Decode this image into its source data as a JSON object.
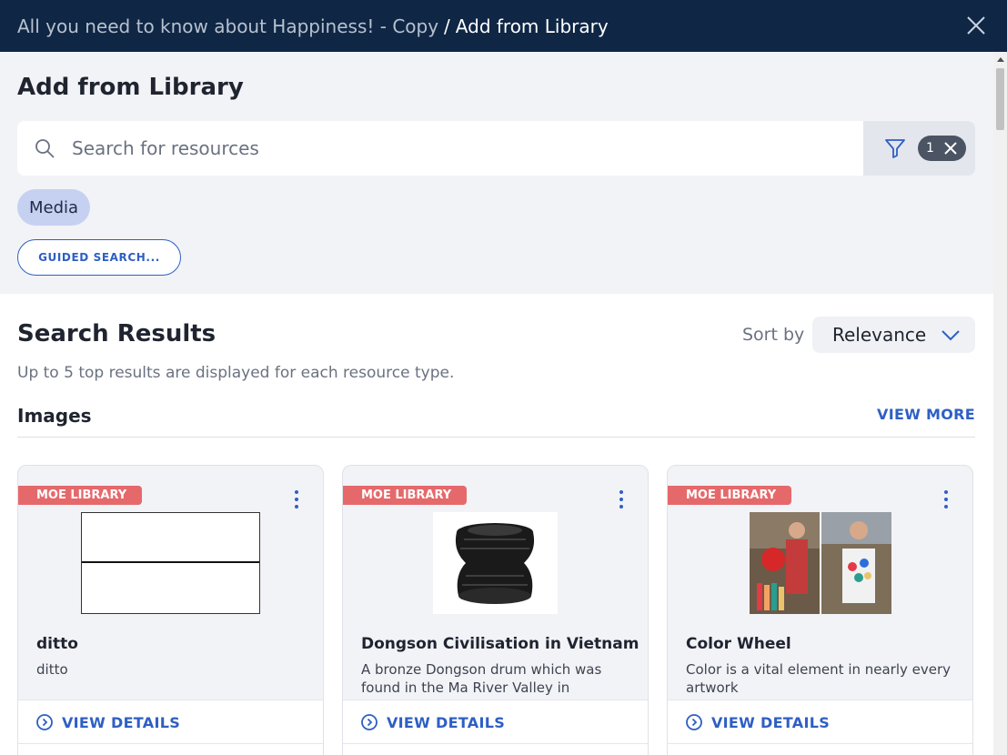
{
  "header": {
    "breadcrumb_parent": "All you need to know about Happiness! - Copy",
    "breadcrumb_separator": "/",
    "breadcrumb_current": "Add from Library",
    "close_icon": "close-icon"
  },
  "page": {
    "title": "Add from Library"
  },
  "search": {
    "placeholder": "Search for resources",
    "value": "",
    "filter_icon": "filter-icon",
    "filter_count": "1"
  },
  "filters": {
    "chips": [
      "Media"
    ],
    "guided_search_label": "GUIDED SEARCH..."
  },
  "results": {
    "title": "Search Results",
    "sort_label": "Sort by",
    "sort_value": "Relevance",
    "note": "Up to 5 top results are displayed for each resource type."
  },
  "images_section": {
    "title": "Images",
    "view_more": "VIEW MORE",
    "cards": [
      {
        "badge": "MOE LIBRARY",
        "title": "ditto",
        "description": "ditto",
        "action": "VIEW DETAILS"
      },
      {
        "badge": "MOE LIBRARY",
        "title": "Dongson Civilisation in Vietnam",
        "description": "A bronze Dongson drum which was found in the Ma River Valley in",
        "action": "VIEW DETAILS"
      },
      {
        "badge": "MOE LIBRARY",
        "title": "Color Wheel",
        "description": "Color is a vital element in nearly every artwork",
        "action": "VIEW DETAILS"
      }
    ]
  },
  "colors": {
    "header_bg": "#0f2645",
    "accent": "#2e5fc4",
    "badge": "#e5696b",
    "chip_bg": "#c6d1f2"
  }
}
